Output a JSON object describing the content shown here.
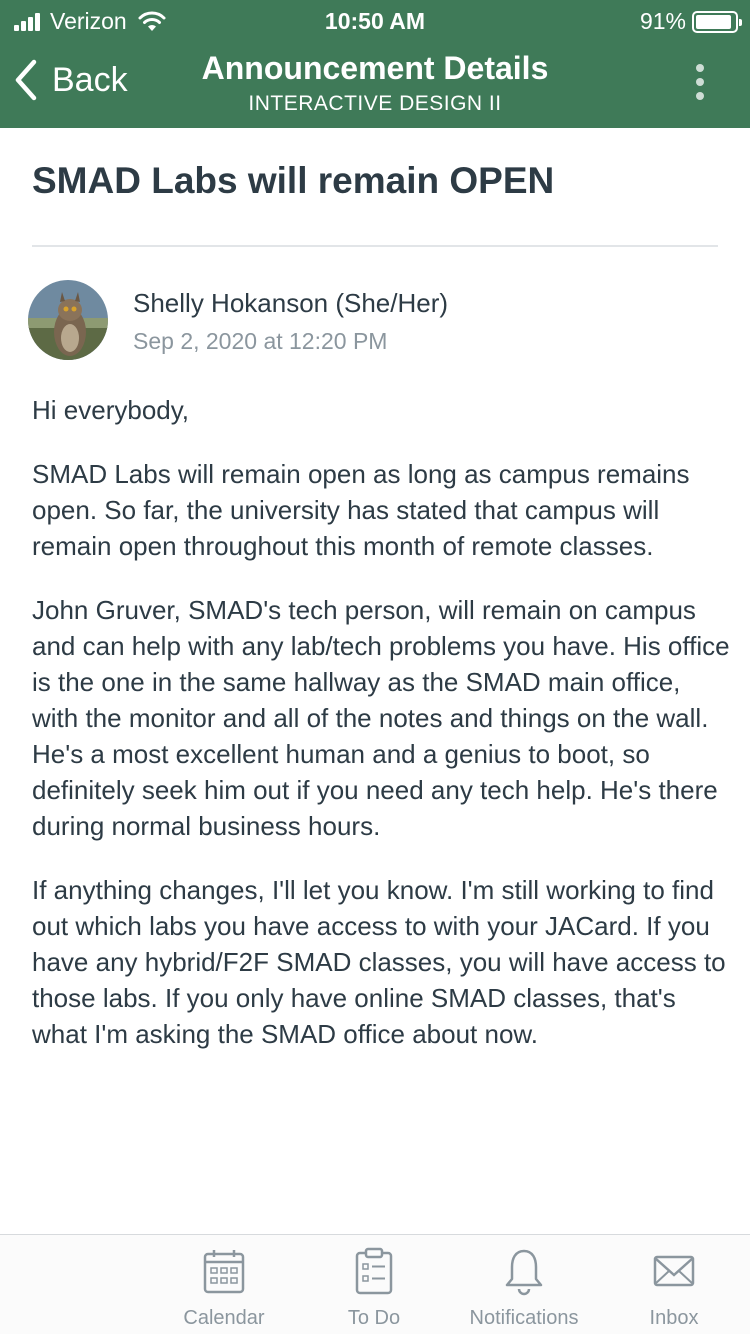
{
  "status_bar": {
    "carrier": "Verizon",
    "time": "10:50 AM",
    "battery": "91%",
    "battery_level": 0.91
  },
  "nav": {
    "back_label": "Back",
    "title": "Announcement Details",
    "subtitle": "INTERACTIVE DESIGN II"
  },
  "announcement": {
    "title": "SMAD Labs will remain OPEN",
    "author": "Shelly Hokanson (She/Her)",
    "date": "Sep 2, 2020 at 12:20 PM",
    "paragraphs": [
      "Hi everybody,",
      "SMAD Labs will remain open as long as campus remains open. So far, the university has stated that campus will remain open throughout this month of remote classes.",
      "John Gruver, SMAD's tech person, will remain on campus and can help with any lab/tech problems you have. His office is the one in the same hallway as the SMAD main office, with the monitor and all of the notes and things on the wall. He's a most excellent human and a genius to boot, so definitely seek him out if you need any tech help. He's there during normal business hours.",
      "If anything changes, I'll let you know. I'm still working to find out which labs you have access to with your JACard. If you have any hybrid/F2F SMAD classes, you will have access to those labs. If you only have online SMAD classes, that's what I'm asking the SMAD office about now."
    ]
  },
  "tabbar": {
    "tabs": [
      {
        "label": "Calendar",
        "icon": "calendar-icon"
      },
      {
        "label": "To Do",
        "icon": "todo-clipboard-icon"
      },
      {
        "label": "Notifications",
        "icon": "bell-icon"
      },
      {
        "label": "Inbox",
        "icon": "envelope-icon"
      }
    ]
  },
  "colors": {
    "header_green": "#3f7a58",
    "text": "#2d3b45",
    "muted": "#8b969e"
  }
}
